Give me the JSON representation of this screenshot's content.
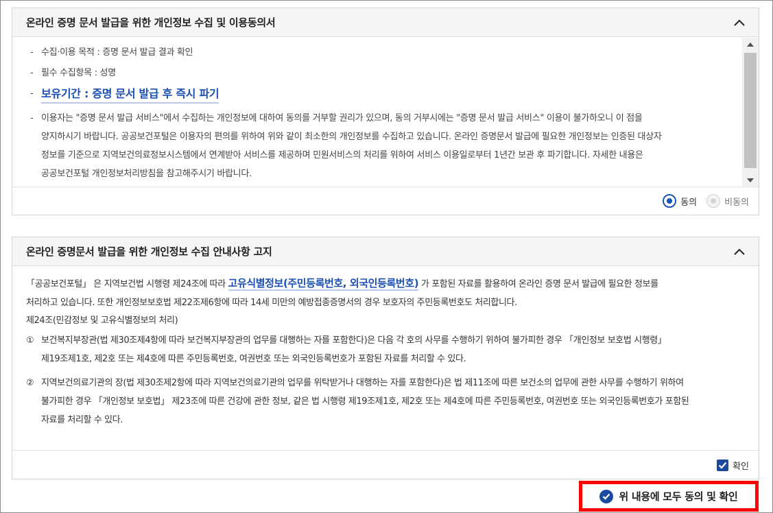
{
  "panel1": {
    "title": "온라인 증명 문서 발급을 위한 개인정보 수집 및 이용동의서",
    "items": [
      "수집·이용 목적 : 증명 문서 발급 결과 확인",
      "필수 수집항목 : 성명"
    ],
    "retention": "보유기간 : 증명 문서 발급 후 즉시 파기",
    "long_lines": [
      "이용자는 \"증명 문서 발급 서비스\"에서 수집하는 개인정보에 대하여 동의를 거부할 권리가 있으며, 동의 거부시에는 \"증명 문서 발급 서비스\" 이용이 불가하오니 이 점을",
      "양지하시기 바랍니다. 공공보건포털은 이용자의 편의를 위하여 위와 같이 최소한의 개인정보를 수집하고 있습니다. 온라인 증명문서 발급에 필요한 개인정보는 인증된 대상자",
      "정보를 기준으로 지역보건의료정보시스템에서 연계받아 서비스를 제공하며 민원서비스의 처리를 위하여 서비스 이용일로부터 1년간 보관 후 파기합니다. 자세한 내용은",
      "공공보건포털 개인정보처리방침을 참고해주시기 바랍니다."
    ],
    "agree_label": "동의",
    "disagree_label": "비동의",
    "selected": "agree"
  },
  "panel2": {
    "title": "온라인 증명문서 발급을 위한 개인정보 수집 안내사항 고지",
    "intro_before": "「공공보건포털」 은 지역보건법 시행령 제24조에 따라 ",
    "intro_highlight": "고유식별정보(주민등록번호, 외국인등록번호)",
    "intro_after": " 가 포함된 자료를 활용하여 온라인 증명 문서 발급에 필요한 정보를",
    "intro_line2": "처리하고 있습니다. 또한 개인정보보호법 제22조제6항에 따라 14세 미만의 예방접종증명서의 경우 보호자의 주민등록번호도 처리합니다.",
    "article_title": "제24조(민감정보 및 고유식별정보의 처리)",
    "clauses": [
      {
        "num": "①",
        "line1": "보건복지부장관(법 제30조제4항에 따라 보건복지부장관의 업무를 대행하는 자를 포함한다)은 다음 각 호의 사무를 수행하기 위하여 불가피한 경우 「개인정보 보호법 시행령」",
        "line2": "제19조제1호, 제2호 또는 제4호에 따른 주민등록번호, 여권번호 또는 외국인등록번호가 포함된 자료를 처리할 수 있다.",
        "line3": ""
      },
      {
        "num": "②",
        "line1": "지역보건의료기관의 장(법 제30조제2항에 따라 지역보건의료기관의 업무를 위탁받거나 대행하는 자를 포함한다)은 법 제11조에 따른 보건소의 업무에 관한 사무를 수행하기 위하여",
        "line2": "불가피한 경우 「개인정보 보호법」 제23조에 따른 건강에 관한 정보, 같은 법 시행령 제19조제1호, 제2호 또는 제4호에 따른 주민등록번호, 여권번호 또는 외국인등록번호가 포함된",
        "line3": "자료를 처리할 수 있다."
      }
    ],
    "confirm_label": "확인",
    "confirmed": true
  },
  "all_agree_label": "위 내용에 모두 동의 및 확인",
  "colors": {
    "accent": "#1a4aa0",
    "highlight_text": "#1b4fb3",
    "frame": "#ff0000"
  },
  "icons": {
    "collapse": "chevron-up-icon",
    "scroll_up": "triangle-up-icon",
    "scroll_down": "triangle-down-icon",
    "check": "check-icon"
  }
}
